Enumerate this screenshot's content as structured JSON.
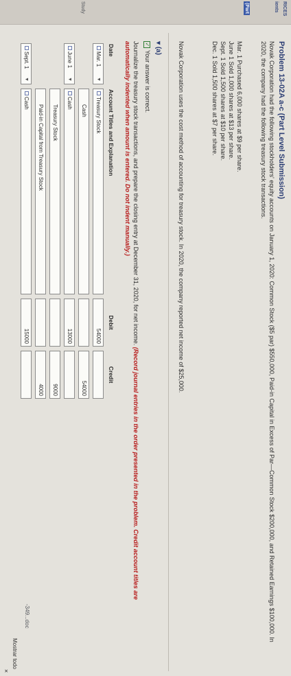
{
  "sidebar": {
    "labels": [
      "RICES",
      "ients",
      "(Part",
      "Study",
      "-349...doc"
    ],
    "accent_color": "#3a5aa8"
  },
  "problem": {
    "title": "Problem 13-02A a-c (Part Level Submission)",
    "intro": "Novak Corporation had the following stockholders' equity accounts on January 1, 2020: Common Stock ($5 par) $550,000, Paid-in Capital in Excess of Par—Common Stock $200,000, and Retained Earnings $100,000. In 2020, the company had the following treasury stock transactions.",
    "transactions": [
      "Mar. 1  Purchased 6,000 shares at $9 per share.",
      "June 1  Sold 1,000 shares at $13 per share.",
      "Sept. 1  Sold 1,500 shares at $10 per share.",
      "Dec. 1  Sold 1,500 shares at $7 per share."
    ],
    "method": "Novak Corporation uses the cost method of accounting for treasury stock. In 2020, the company reported net income of $25,000."
  },
  "part_a": {
    "label": "(a)",
    "status": "Your answer is correct.",
    "instruction": "Journalize the treasury stock transactions, and prepare the closing entry at December 31, 2020, for net income.",
    "instruction_emph": "(Record journal entries in the order presented in the problem. Credit account titles are automatically indented when amount is entered. Do not indent manually.)"
  },
  "journal": {
    "headers": {
      "date": "Date",
      "account": "Account Titles and Explanation",
      "debit": "Debit",
      "credit": "Credit"
    },
    "rows": [
      {
        "date": "Mar. 1",
        "account": "Treasury Stock",
        "debit": "54000",
        "credit": ""
      },
      {
        "date": "",
        "account": "Cash",
        "debit": "",
        "credit": "54000"
      },
      {
        "date": "June 1",
        "account": "Cash",
        "debit": "13000",
        "credit": ""
      },
      {
        "date": "",
        "account": "Treasury Stock",
        "debit": "",
        "credit": "9000"
      },
      {
        "date": "",
        "account": "Paid-in Capital from Treasury Stock",
        "debit": "",
        "credit": "4000"
      },
      {
        "date": "Sept. 1",
        "account": "Cash",
        "debit": "15000",
        "credit": ""
      }
    ]
  },
  "footer": {
    "file": "-349...doc",
    "show_all": "Mostrar todo",
    "close": "×"
  }
}
